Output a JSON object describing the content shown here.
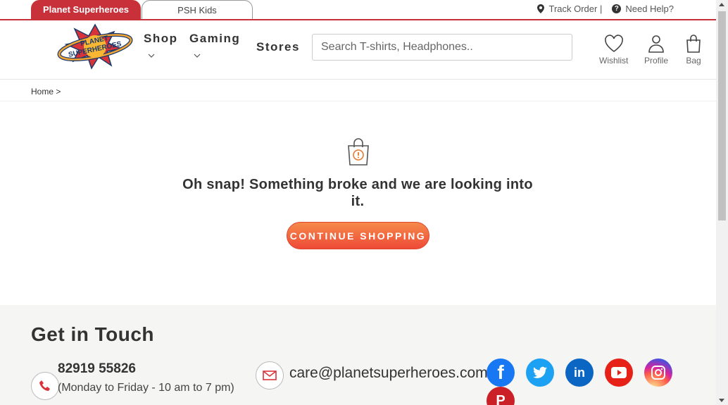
{
  "site_tabs": [
    {
      "label": "Planet Superheroes",
      "active": true
    },
    {
      "label": "PSH Kids",
      "active": false
    }
  ],
  "top_links": {
    "track_order": "Track Order |",
    "need_help": "Need Help?",
    "track_icon": "location-pin-icon",
    "help_icon": "question-circle-icon"
  },
  "header": {
    "logo_text_line1": "PLANET",
    "logo_text_line2": "SUPERHEROES",
    "nav": [
      {
        "label": "Shop",
        "has_dropdown": true
      },
      {
        "label": "Gaming",
        "has_dropdown": true
      },
      {
        "label": "Stores",
        "has_dropdown": false
      }
    ],
    "search_placeholder": "Search T-shirts, Headphones..",
    "icons": [
      {
        "label": "Wishlist",
        "icon": "heart-icon"
      },
      {
        "label": "Profile",
        "icon": "user-icon"
      },
      {
        "label": "Bag",
        "icon": "bag-icon"
      }
    ]
  },
  "breadcrumb": "Home >",
  "error": {
    "icon": "bag-alert-icon",
    "message": "Oh snap! Something broke and we are looking into it.",
    "cta_label": "CONTINUE SHOPPING"
  },
  "footer": {
    "heading": "Get in Touch",
    "phone": "82919 55826",
    "phone_hours": "(Monday to Friday - 10 am to 7 pm)",
    "email": "care@planetsuperheroes.com",
    "social": [
      {
        "name": "facebook-icon",
        "glyph": "f",
        "color": "#1877f2"
      },
      {
        "name": "twitter-icon",
        "glyph": "🐦",
        "color": "#1da1f2"
      },
      {
        "name": "linkedin-icon",
        "glyph": "in",
        "color": "#0a66c2"
      },
      {
        "name": "youtube-icon",
        "glyph": "▶",
        "color": "#e62117"
      },
      {
        "name": "instagram-icon",
        "glyph": "◎",
        "color": "#c13584"
      },
      {
        "name": "pinterest-icon",
        "glyph": "P",
        "color": "#cb2027"
      }
    ]
  },
  "colors": {
    "brand_red": "#c8303a",
    "cta_gradient_top": "#f58a4b",
    "cta_gradient_bottom": "#ee4a37"
  }
}
